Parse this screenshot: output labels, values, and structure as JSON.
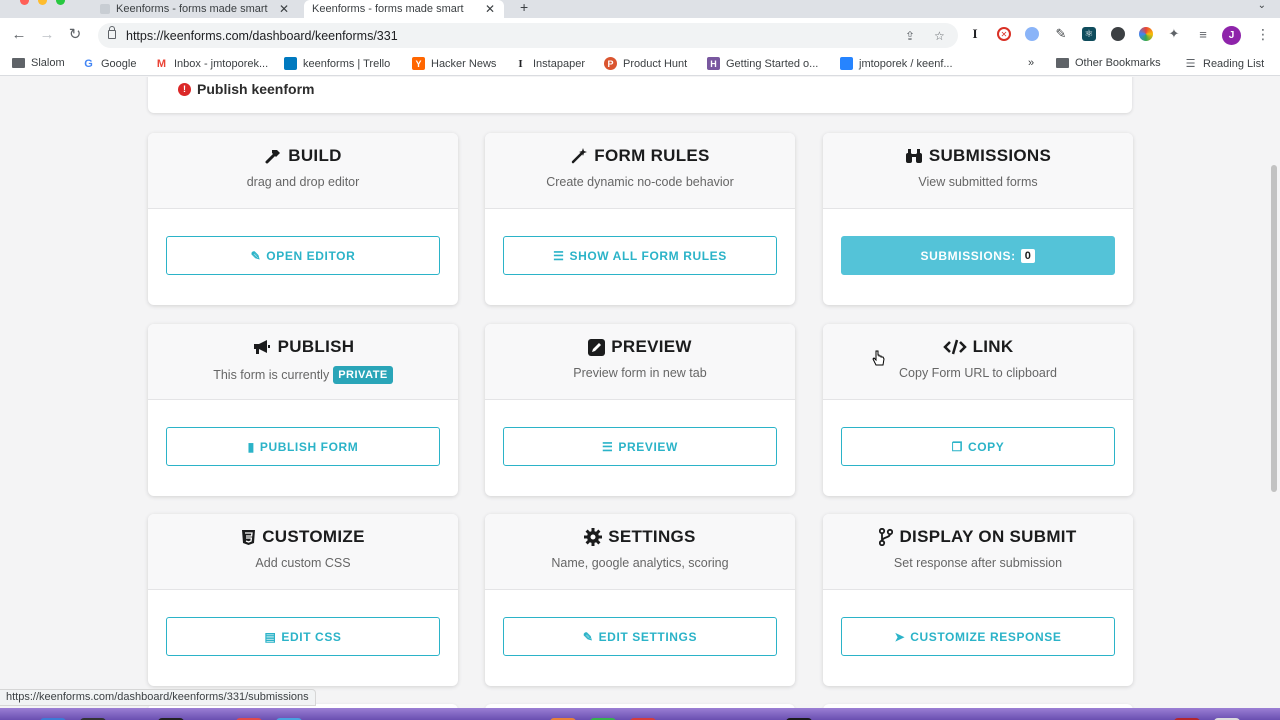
{
  "browser": {
    "tabs": [
      {
        "title": "Keenforms - forms made smart",
        "active": false
      },
      {
        "title": "Keenforms - forms made smart",
        "active": true
      }
    ],
    "url": "https://keenforms.com/dashboard/keenforms/331",
    "bookmarks": [
      {
        "label": "Slalom",
        "icon": "folder-icon"
      },
      {
        "label": "Google",
        "icon": "google-icon"
      },
      {
        "label": "Inbox - jmtoporek...",
        "icon": "gmail-icon"
      },
      {
        "label": "keenforms | Trello",
        "icon": "trello-icon"
      },
      {
        "label": "Hacker News",
        "icon": "hacker-news-icon"
      },
      {
        "label": "Instapaper",
        "icon": "instapaper-icon"
      },
      {
        "label": "Product Hunt",
        "icon": "product-hunt-icon"
      },
      {
        "label": "Getting Started o...",
        "icon": "heroku-icon"
      },
      {
        "label": "jmtoporek / keenf...",
        "icon": "bitbucket-icon"
      }
    ],
    "other_bookmarks": "Other Bookmarks",
    "reading_list": "Reading List",
    "profile_initial": "J",
    "status_url": "https://keenforms.com/dashboard/keenforms/331/submissions"
  },
  "top_card": {
    "label": "Publish keenform"
  },
  "cards": {
    "build": {
      "title": "BUILD",
      "subtitle": "drag and drop editor",
      "button": "OPEN EDITOR"
    },
    "form_rules": {
      "title": "FORM RULES",
      "subtitle": "Create dynamic no-code behavior",
      "button": "SHOW ALL FORM RULES"
    },
    "submissions": {
      "title": "SUBMISSIONS",
      "subtitle": "View submitted forms",
      "button": "SUBMISSIONS:",
      "count": "0"
    },
    "publish": {
      "title": "PUBLISH",
      "subtitle": "This form is currently",
      "badge": "PRIVATE",
      "button": "PUBLISH FORM"
    },
    "preview": {
      "title": "PREVIEW",
      "subtitle": "Preview form in new tab",
      "button": "PREVIEW"
    },
    "link": {
      "title": "LINK",
      "subtitle": "Copy Form URL to clipboard",
      "button": "COPY"
    },
    "customize": {
      "title": "CUSTOMIZE",
      "subtitle": "Add custom CSS",
      "button": "EDIT CSS"
    },
    "settings": {
      "title": "SETTINGS",
      "subtitle": "Name, google analytics, scoring",
      "button": "EDIT SETTINGS"
    },
    "display_on_submit": {
      "title": "DISPLAY ON SUBMIT",
      "subtitle": "Set response after submission",
      "button": "CUSTOMIZE RESPONSE"
    }
  },
  "colors": {
    "accent": "#2bb3c8",
    "accent_filled": "#54c3d8",
    "badge": "#2aa5b8",
    "warning": "#db2828"
  }
}
